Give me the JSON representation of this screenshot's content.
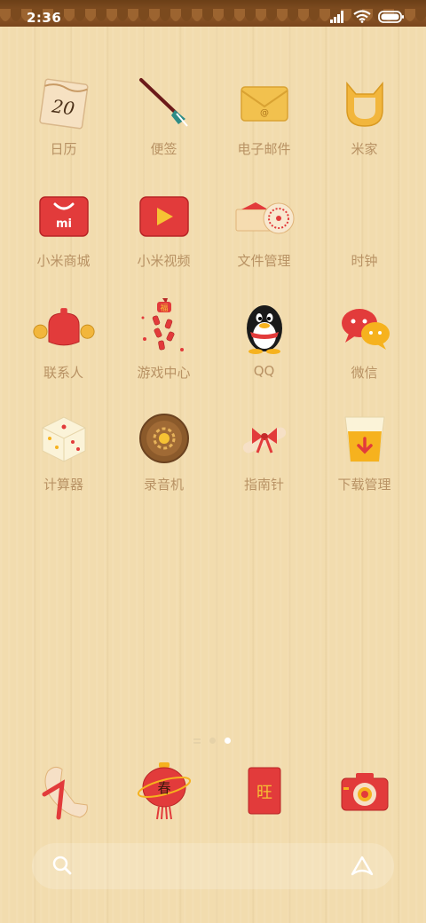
{
  "status_bar": {
    "time": "2:36"
  },
  "apps": [
    {
      "label": "日历",
      "icon": "calendar-icon",
      "icon_text": "20"
    },
    {
      "label": "便签",
      "icon": "brush-notes-icon"
    },
    {
      "label": "电子邮件",
      "icon": "envelope-icon"
    },
    {
      "label": "米家",
      "icon": "mi-home-icon"
    },
    {
      "label": "小米商城",
      "icon": "shopping-bag-icon",
      "icon_text": "mi"
    },
    {
      "label": "小米视频",
      "icon": "video-play-icon"
    },
    {
      "label": "文件管理",
      "icon": "file-fan-icon"
    },
    {
      "label": "时钟",
      "icon": "clock-icon"
    },
    {
      "label": "联系人",
      "icon": "contacts-drum-icon"
    },
    {
      "label": "游戏中心",
      "icon": "firecracker-icon",
      "icon_text": "福"
    },
    {
      "label": "QQ",
      "icon": "qq-penguin-icon"
    },
    {
      "label": "微信",
      "icon": "wechat-bubbles-icon"
    },
    {
      "label": "计算器",
      "icon": "dice-icon"
    },
    {
      "label": "录音机",
      "icon": "copper-coin-icon"
    },
    {
      "label": "指南针",
      "icon": "scroll-bow-icon"
    },
    {
      "label": "下载管理",
      "icon": "glass-download-icon"
    }
  ],
  "page_indicator": {
    "pages": 2,
    "active": 2
  },
  "dock": [
    {
      "icon": "phone-scroll-icon"
    },
    {
      "icon": "lantern-browser-icon",
      "icon_text": "春"
    },
    {
      "icon": "red-envelope-icon",
      "icon_text": "旺"
    },
    {
      "icon": "camera-icon"
    }
  ],
  "colors": {
    "label": "#b89264",
    "accent_red": "#e03b3b",
    "wood": "#f2dcae"
  }
}
